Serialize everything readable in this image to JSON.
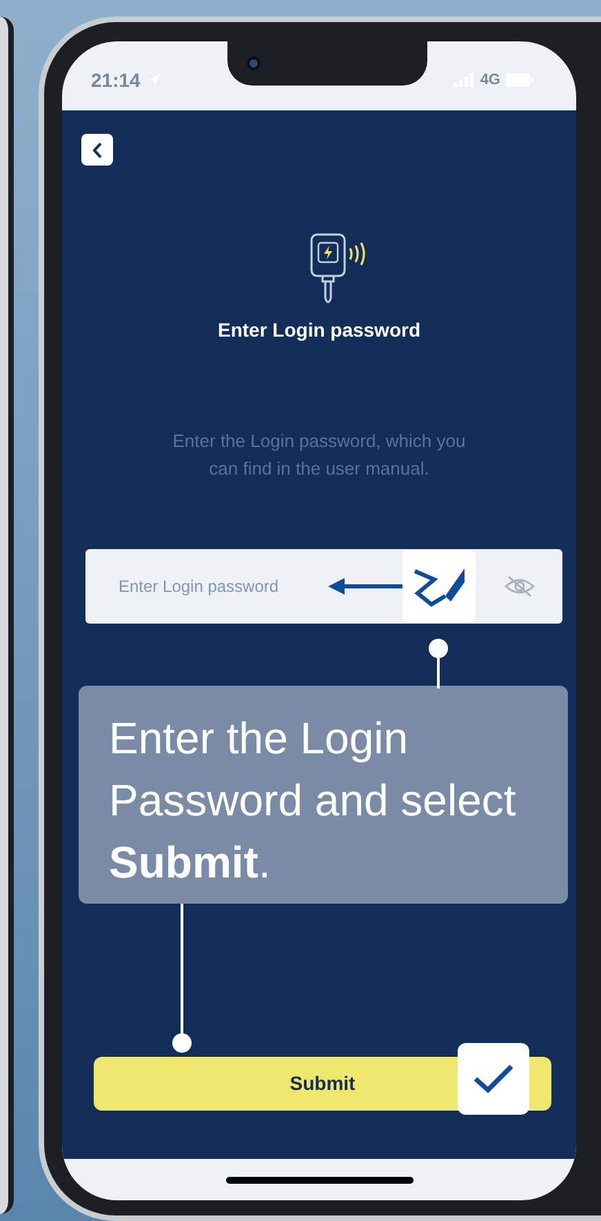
{
  "status_bar": {
    "time": "21:14",
    "network": "4G"
  },
  "screen": {
    "title": "Enter Login password",
    "description": "Enter the Login password, which you can find in the user manual.",
    "password_field": {
      "placeholder": "Enter Login password"
    },
    "submit_button": {
      "label": "Submit"
    }
  },
  "callout": {
    "text": "Enter the Login Password and select **Submit**."
  }
}
